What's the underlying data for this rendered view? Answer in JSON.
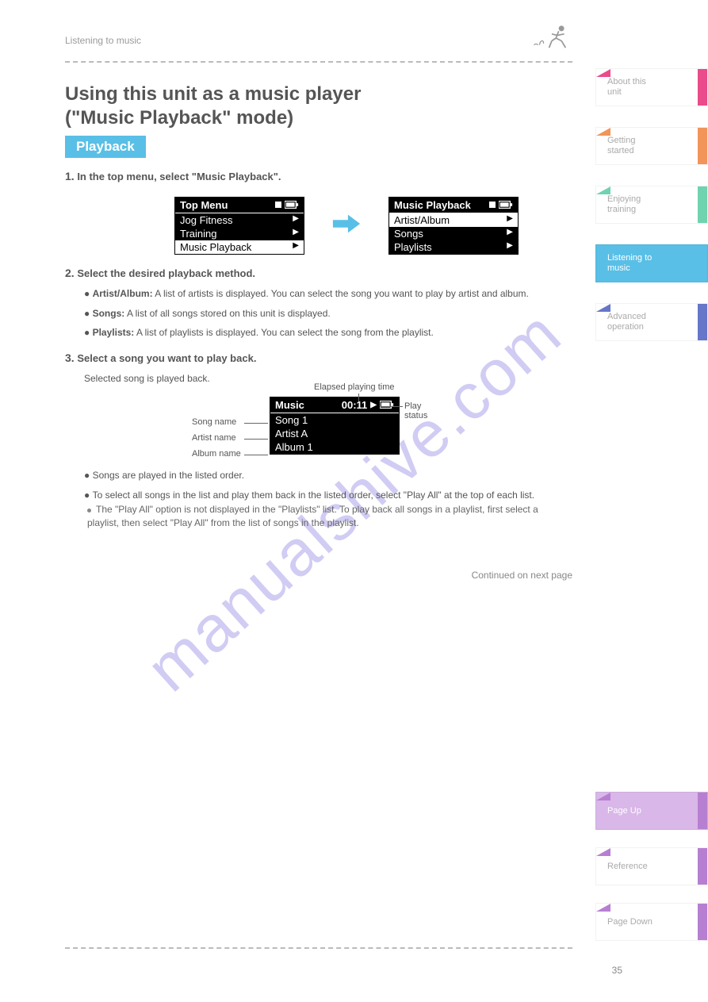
{
  "header": {
    "label": "Listening to music"
  },
  "title": {
    "line1": "Using this unit as a music player",
    "line2": "(\"Music Playback\" mode)"
  },
  "section_label": "Playback",
  "steps": {
    "s1": {
      "num": "1.",
      "text": "In the top menu, select \"Music Playback\"."
    },
    "s2": {
      "num": "2.",
      "text_a": "Select the desired playback method.",
      "bullets": {
        "b1": {
          "label": "Artist/Album:",
          "desc": "A list of artists is displayed. You can select the song you want to play by artist and album."
        },
        "b2": {
          "label": "Songs:",
          "desc": "A list of all songs stored on this unit is displayed."
        },
        "b3": {
          "label": "Playlists:",
          "desc": "A list of playlists is displayed. You can select the song from the playlist."
        }
      }
    },
    "s3": {
      "num": "3.",
      "line1": "Select a song you want to play back.",
      "line2": "Selected song is played back.",
      "notes": {
        "n1": "Songs are played in the listed order.",
        "n2_a": "To select all songs in the list and play them back in the listed order, select \"Play All\" at the top of each list.",
        "n2_b": "The \"Play All\" option is not displayed in the \"Playlists\" list. To play back all songs in a playlist, first select a playlist, then select \"Play All\" from the list of songs in the playlist."
      }
    }
  },
  "screens": {
    "top_menu": {
      "title": "Top Menu",
      "rows": [
        "Jog Fitness",
        "Training",
        "Music Playback"
      ]
    },
    "music_playback": {
      "title": "Music Playback",
      "rows": [
        "Artist/Album",
        "Songs",
        "Playlists"
      ]
    },
    "music": {
      "title": "Music",
      "time": "00:11",
      "song": "Song 1",
      "artist": "Artist A",
      "album": "Album 1"
    }
  },
  "pointers": {
    "play_status": "Play status",
    "song_name": "Song name",
    "artist_name": "Artist name",
    "album_name": "Album name",
    "elapsed": "Elapsed playing time"
  },
  "tabs": {
    "t1": {
      "l1": "About this",
      "l2": "unit"
    },
    "t2": {
      "l1": "Getting",
      "l2": "started"
    },
    "t3": {
      "l1": "Enjoying",
      "l2": "training"
    },
    "t4": {
      "l1": "Listening to",
      "l2": "music"
    },
    "t5": {
      "l1": "Advanced",
      "l2": "operation"
    },
    "b1": {
      "l1": "Page Up"
    },
    "b2": {
      "l1": "Reference"
    },
    "b3": {
      "l1": "Page Down"
    }
  },
  "continued": "Continued on next page",
  "page_number": "35"
}
